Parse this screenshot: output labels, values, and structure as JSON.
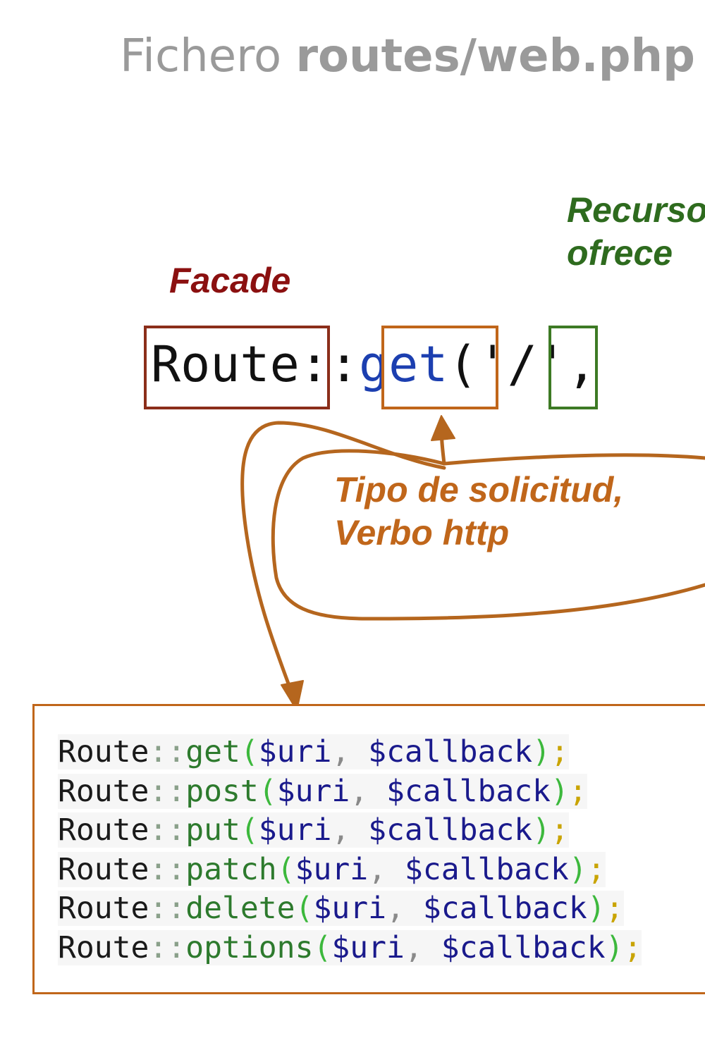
{
  "title": {
    "regular": "Fichero ",
    "bold": "routes/web.php"
  },
  "labels": {
    "facade": "Facade",
    "recurso_line1": "Recurso",
    "recurso_line2": "ofrece",
    "tipo_line1": "Tipo de solicitud,",
    "tipo_line2": "Verbo http"
  },
  "code": {
    "route": "Route",
    "sep": "::",
    "method": "get",
    "open": "('",
    "uri": "/",
    "close": "',"
  },
  "methods": [
    {
      "prefix": "Route",
      "sep": "::",
      "name": "get",
      "open": "(",
      "arg1": "$uri",
      "comma": ", ",
      "arg2": "$callback",
      "close": ")",
      "semi": ";"
    },
    {
      "prefix": "Route",
      "sep": "::",
      "name": "post",
      "open": "(",
      "arg1": "$uri",
      "comma": ", ",
      "arg2": "$callback",
      "close": ")",
      "semi": ";"
    },
    {
      "prefix": "Route",
      "sep": "::",
      "name": "put",
      "open": "(",
      "arg1": "$uri",
      "comma": ", ",
      "arg2": "$callback",
      "close": ")",
      "semi": ";"
    },
    {
      "prefix": "Route",
      "sep": "::",
      "name": "patch",
      "open": "(",
      "arg1": "$uri",
      "comma": ", ",
      "arg2": "$callback",
      "close": ")",
      "semi": ";"
    },
    {
      "prefix": "Route",
      "sep": "::",
      "name": "delete",
      "open": "(",
      "arg1": "$uri",
      "comma": ", ",
      "arg2": "$callback",
      "close": ")",
      "semi": ";"
    },
    {
      "prefix": "Route",
      "sep": "::",
      "name": "options",
      "open": "(",
      "arg1": "$uri",
      "comma": ", ",
      "arg2": "$callback",
      "close": ")",
      "semi": ";"
    }
  ],
  "colors": {
    "facade": "#8b1010",
    "recurso": "#2e6b1e",
    "tipo": "#c0661a",
    "arrow": "#b5661e"
  }
}
